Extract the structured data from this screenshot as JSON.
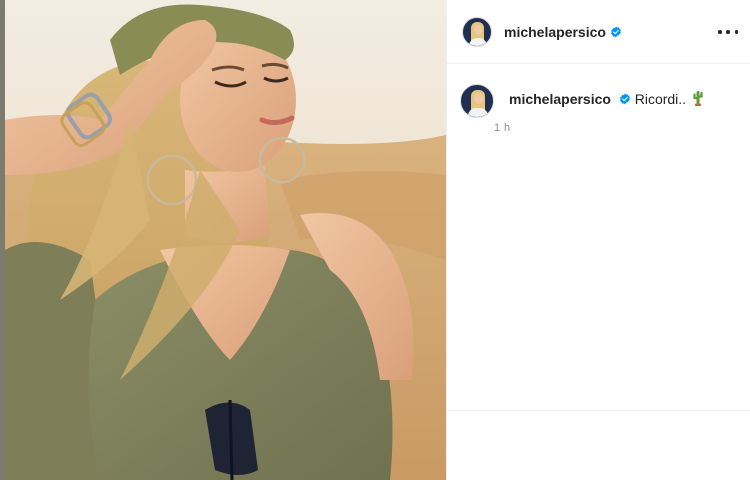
{
  "post": {
    "username": "michelapersico",
    "caption_text": "Ricordi..",
    "caption_emoji": "cactus-emoji",
    "timestamp": "1 h"
  },
  "icons": {
    "verified": "verified-badge-icon",
    "more": "more-options-icon"
  },
  "colors": {
    "verified_blue": "#0095f6",
    "username_text": "#262626",
    "secondary_text": "#8e8e8e",
    "divider": "#efefef"
  }
}
